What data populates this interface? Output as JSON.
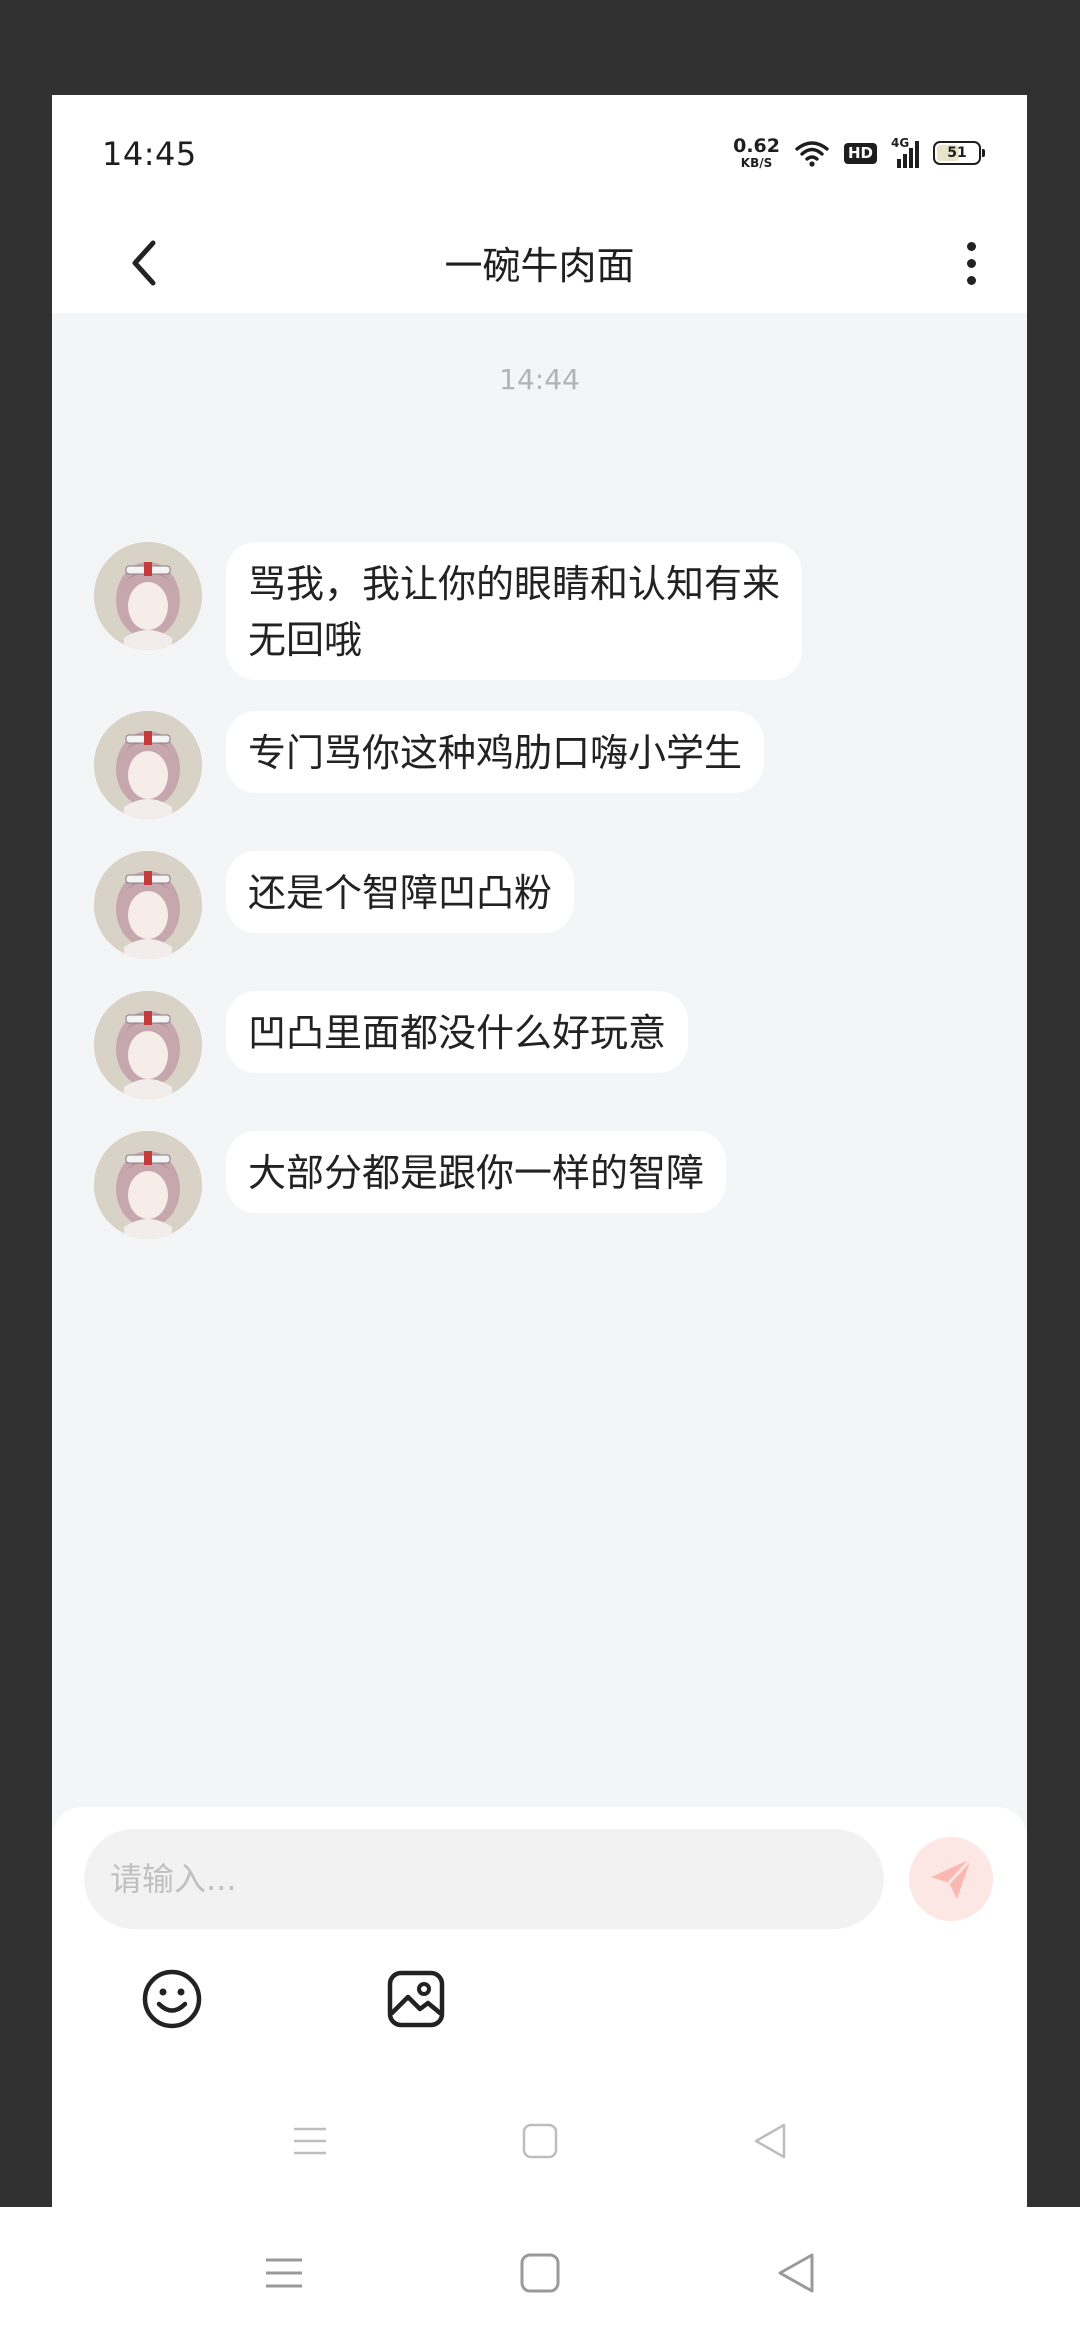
{
  "status_bar": {
    "time": "14:45",
    "net_speed_value": "0.62",
    "net_speed_unit": "KB/S",
    "hd_label": "HD",
    "network_label": "4G",
    "battery_level": "51"
  },
  "header": {
    "title": "一碗牛肉面",
    "back_icon": "chevron-left-icon",
    "more_icon": "more-vertical-icon"
  },
  "messages": {
    "timestamp": "14:44",
    "items": [
      {
        "text_line1": "骂我，我让你的眼睛和认知有来",
        "text_line2": "无回哦"
      },
      {
        "text_line1": "专门骂你这种鸡肋口嗨小学生"
      },
      {
        "text_line1": "还是个智障凹凸粉"
      },
      {
        "text_line1": "凹凸里面都没什么好玩意"
      },
      {
        "text_line1": "大部分都是跟你一样的智障"
      }
    ]
  },
  "input": {
    "placeholder": "请输入...",
    "send_icon": "send-icon",
    "emoji_icon": "smiley-icon",
    "image_icon": "image-icon"
  },
  "colors": {
    "background": "#f4f5f7",
    "bubble": "#ffffff",
    "send_button": "#fde7e5",
    "send_icon": "#fbb8b2",
    "outer_bg": "#313131"
  }
}
